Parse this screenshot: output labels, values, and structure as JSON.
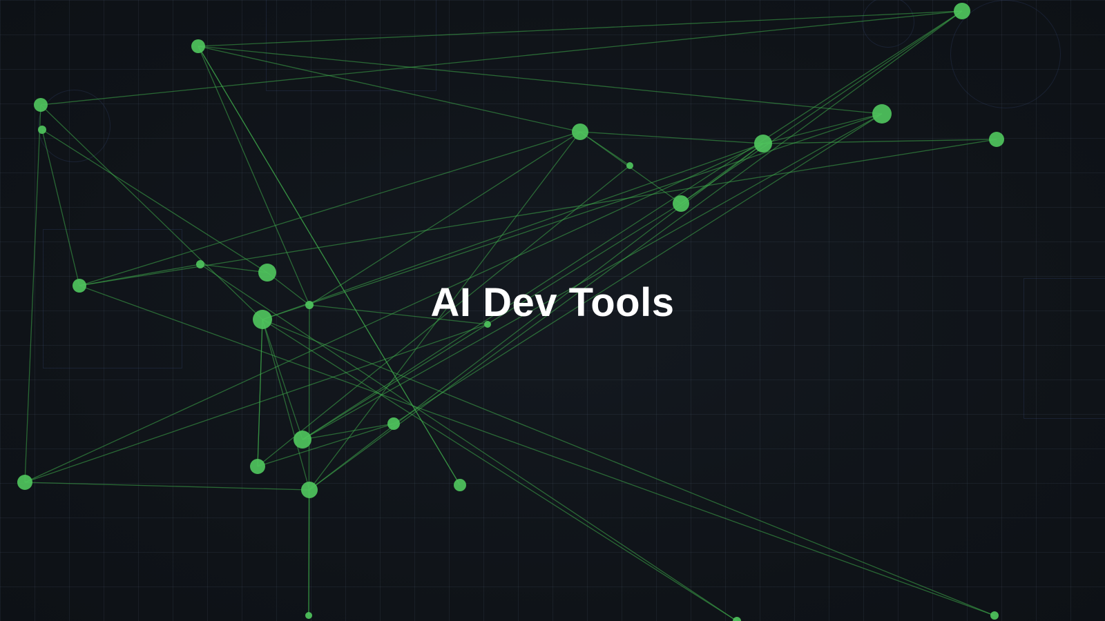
{
  "hero": {
    "title": "AI Dev Tools"
  },
  "colors": {
    "background": "#10141a",
    "grid_line": "#788caa",
    "node": "#4fc45d",
    "edge": "#3fae4c",
    "title": "#ffffff"
  },
  "icons": {
    "network": "network-graph-icon"
  }
}
